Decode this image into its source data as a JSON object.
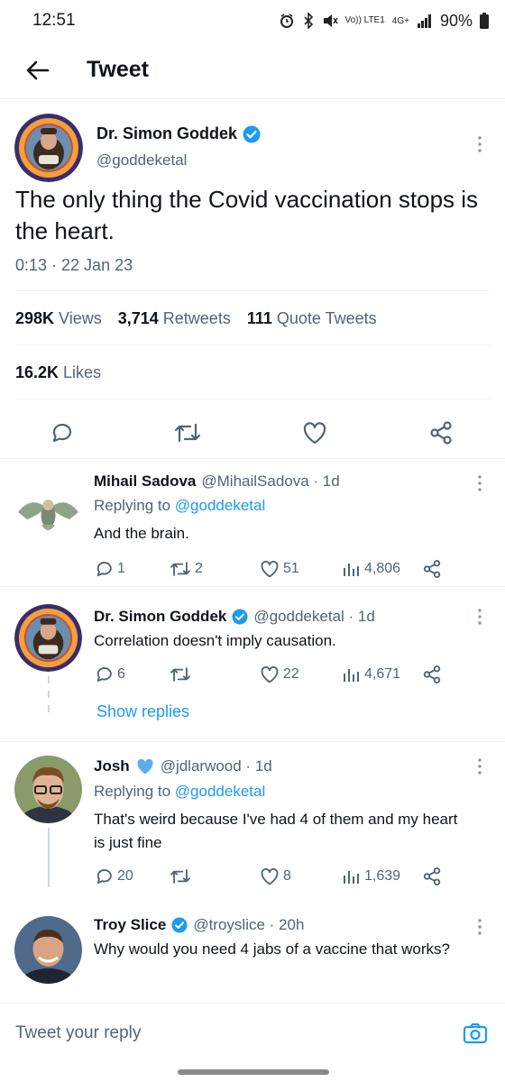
{
  "status_bar": {
    "time": "12:51",
    "network_label": "Vo)) LTE1",
    "network_gen": "4G+",
    "battery": "90%"
  },
  "header": {
    "title": "Tweet"
  },
  "main_tweet": {
    "author_name": "Dr. Simon Goddek",
    "handle": "@goddeketal",
    "text": "The only thing the Covid vaccination stops is the heart.",
    "timestamp": "0:13 · 22 Jan 23",
    "views_count": "298K",
    "views_label": "Views",
    "retweets_count": "3,714",
    "retweets_label": "Retweets",
    "quotes_count": "111",
    "quotes_label": "Quote Tweets",
    "likes_count": "16.2K",
    "likes_label": "Likes"
  },
  "replies": [
    {
      "name": "Mihail Sadova",
      "handle_time": "@MihailSadova · 1d",
      "replying_prefix": "Replying to",
      "replying_to": "@goddeketal",
      "text": "And the brain.",
      "reply_count": "1",
      "retweet_count": "2",
      "like_count": "51",
      "view_count": "4,806"
    },
    {
      "name": "Dr. Simon Goddek",
      "handle_time": "@goddeketal · 1d",
      "text": "Correlation doesn't imply causation.",
      "reply_count": "6",
      "retweet_count": "",
      "like_count": "22",
      "view_count": "4,671",
      "show_replies": "Show replies"
    },
    {
      "name": "Josh",
      "handle_time": "@jdlarwood · 1d",
      "replying_prefix": "Replying to",
      "replying_to": "@goddeketal",
      "text": "That's weird because I've had 4 of them and my heart is just fine",
      "reply_count": "20",
      "retweet_count": "",
      "like_count": "8",
      "view_count": "1,639"
    },
    {
      "name": "Troy Slice",
      "handle_time": "@troyslice · 20h",
      "text": "Why would you need 4 jabs of a vaccine that works?"
    }
  ],
  "reply_bar": {
    "placeholder": "Tweet your reply"
  },
  "colors": {
    "accent": "#1d9bf0",
    "text_primary": "#0f1419",
    "text_secondary": "#536471",
    "divider": "#eff3f4"
  },
  "icons": {
    "back": "arrow-left-icon",
    "verified": "verified-badge-icon",
    "more": "more-vertical-icon",
    "reply": "reply-icon",
    "retweet": "retweet-icon",
    "like": "heart-icon",
    "share": "share-icon",
    "views": "views-icon",
    "camera": "camera-icon"
  }
}
